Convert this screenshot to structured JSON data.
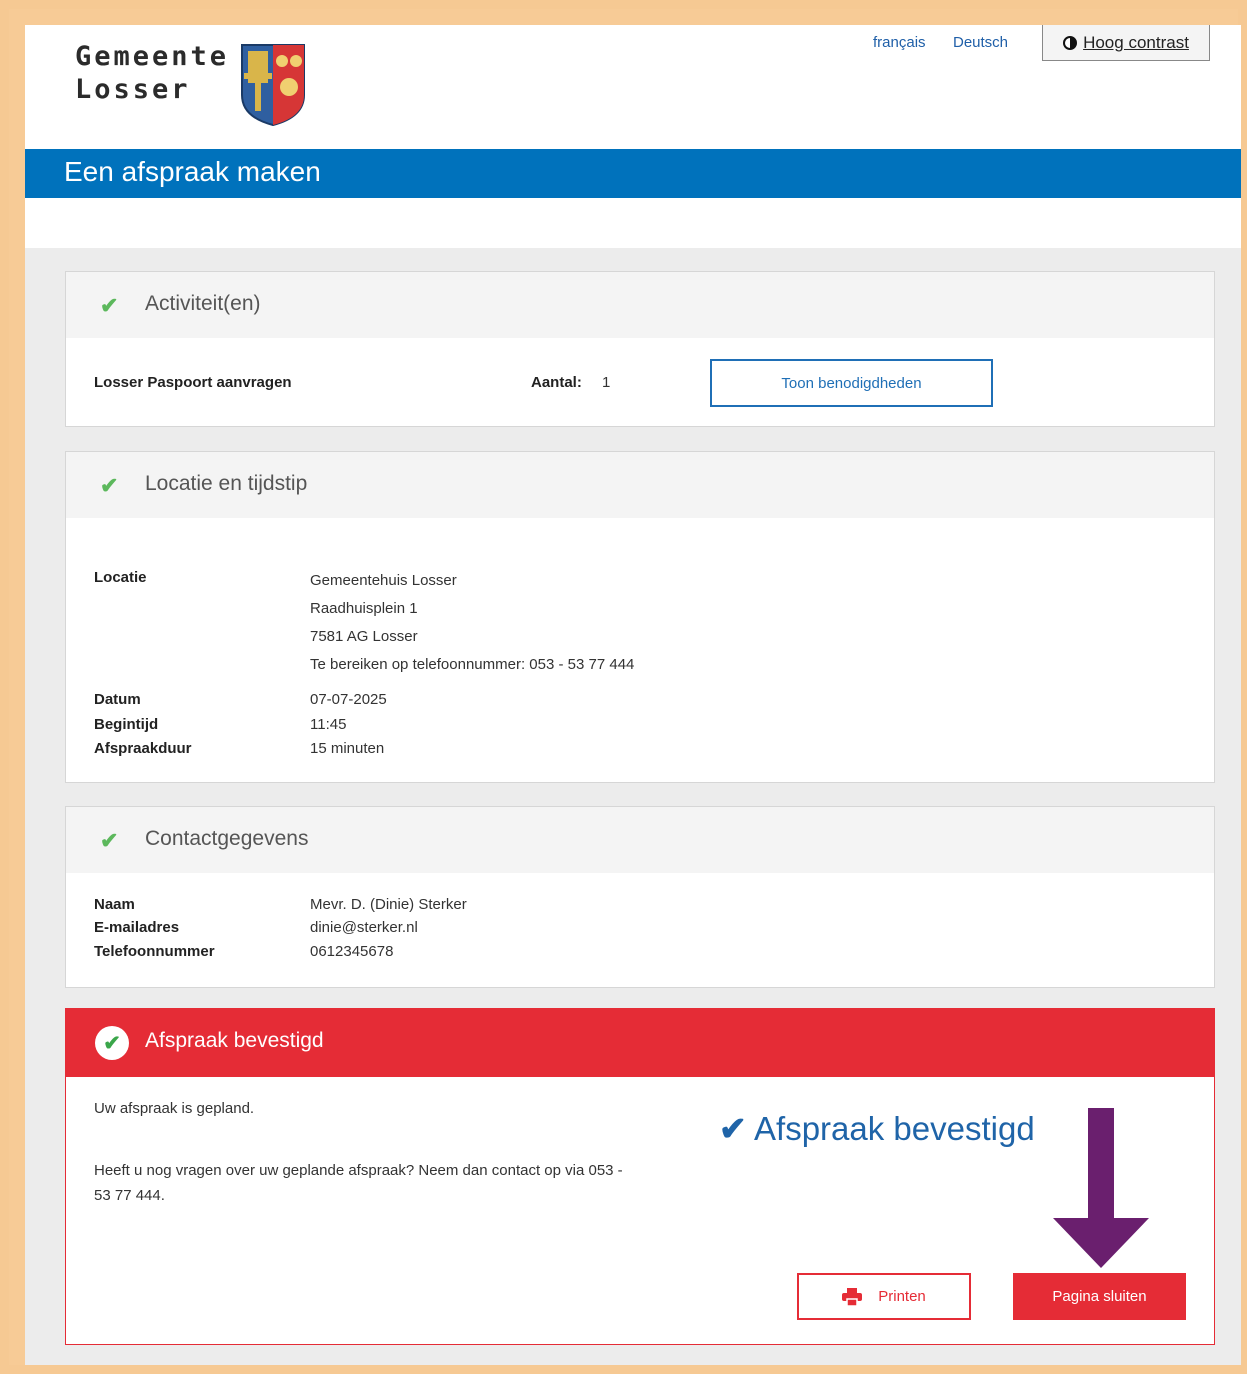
{
  "header": {
    "logo_line1": "Gemeente",
    "logo_line2": "Losser",
    "lang_fr": "français",
    "lang_de": "Deutsch",
    "contrast_label": "Hoog contrast"
  },
  "page_title": "Een afspraak maken",
  "activities": {
    "title": "Activiteit(en)",
    "item_name": "Losser Paspoort aanvragen",
    "count_label": "Aantal:",
    "count_value": "1",
    "requirements_button": "Toon benodigdheden"
  },
  "location": {
    "title": "Locatie en tijdstip",
    "location_label": "Locatie",
    "address_name": "Gemeentehuis Losser",
    "address_street": "Raadhuisplein 1",
    "address_city": "7581 AG Losser",
    "phone_line": "Te bereiken op telefoonnummer: 053 - 53 77 444",
    "date_label": "Datum",
    "date_value": "07-07-2025",
    "start_label": "Begintijd",
    "start_value": "11:45",
    "duration_label": "Afspraakduur",
    "duration_value": "15 minuten"
  },
  "contact": {
    "title": "Contactgegevens",
    "name_label": "Naam",
    "name_value": "Mevr. D. (Dinie) Sterker",
    "email_label": "E-mailadres",
    "email_value": "dinie@sterker.nl",
    "phone_label": "Telefoonnummer",
    "phone_value": "0612345678"
  },
  "confirmation": {
    "title": "Afspraak bevestigd",
    "planned_text": "Uw afspraak is gepland.",
    "questions_line1": "Heeft u nog vragen over uw geplande afspraak? Neem dan contact op via 053 -",
    "questions_line2": "53 77 444.",
    "big_label": "Afspraak bevestigd",
    "print_button": "Printen",
    "close_button": "Pagina sluiten"
  },
  "colors": {
    "brand_blue": "#0072bc",
    "confirm_red": "#e52c36",
    "check_green": "#5cb85c",
    "annotation_arrow": "#6a1f6e",
    "frame_orange": "#f6c993"
  }
}
